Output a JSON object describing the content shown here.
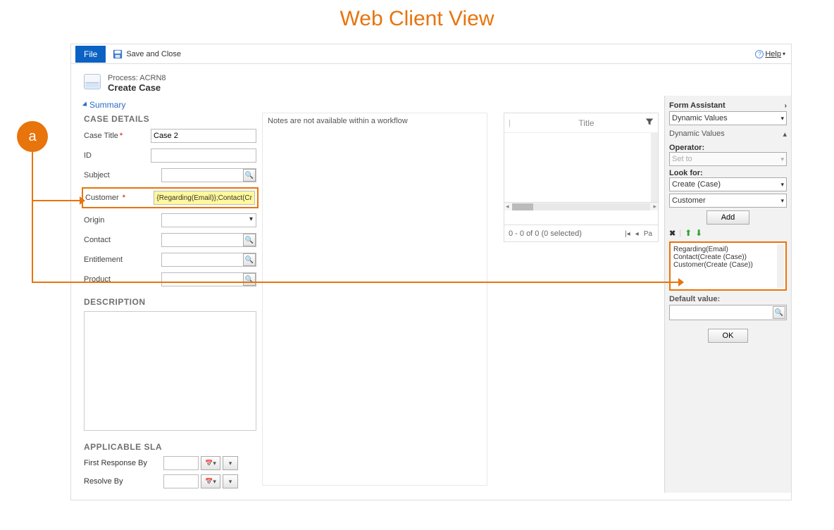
{
  "page_heading": "Web Client View",
  "toolbar": {
    "file_label": "File",
    "save_close_label": "Save and Close",
    "help_label": "Help"
  },
  "header": {
    "process_prefix": "Process: ",
    "process_name": "ACRN8",
    "title": "Create Case"
  },
  "summary_link": "Summary",
  "sections": {
    "case_details": "CASE DETAILS",
    "description": "DESCRIPTION",
    "applicable_sla": "APPLICABLE SLA"
  },
  "fields": {
    "case_title": {
      "label": "Case Title",
      "value": "Case 2",
      "required": true
    },
    "id": {
      "label": "ID",
      "value": ""
    },
    "subject": {
      "label": "Subject",
      "value": ""
    },
    "customer": {
      "label": "Customer",
      "value": "{Regarding(Email)};Contact(Cr",
      "required": true
    },
    "origin": {
      "label": "Origin",
      "value": ""
    },
    "contact": {
      "label": "Contact",
      "value": ""
    },
    "entitlement": {
      "label": "Entitlement",
      "value": ""
    },
    "product": {
      "label": "Product",
      "value": ""
    },
    "first_response_by": {
      "label": "First Response By"
    },
    "resolve_by": {
      "label": "Resolve By"
    }
  },
  "notes_message": "Notes are not available within a workflow",
  "grid": {
    "column_title": "Title",
    "status": "0 - 0 of 0 (0 selected)",
    "page_label": "Pa"
  },
  "assistant": {
    "title": "Form Assistant",
    "dynamic_values": "Dynamic Values",
    "operator_label": "Operator:",
    "operator_value": "Set to",
    "look_for_label": "Look for:",
    "look_for_entity": "Create (Case)",
    "look_for_attr": "Customer",
    "add_label": "Add",
    "list": [
      "Regarding(Email)",
      "Contact(Create (Case))",
      "Customer(Create (Case))"
    ],
    "default_value_label": "Default value:",
    "ok_label": "OK"
  },
  "annotation": {
    "badge": "a"
  }
}
